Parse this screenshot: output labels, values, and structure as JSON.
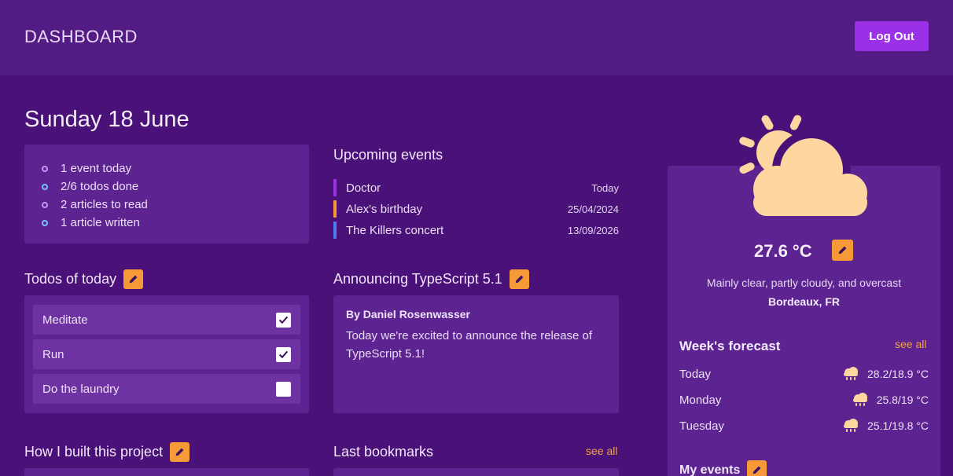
{
  "header": {
    "title": "DASHBOARD",
    "logout_label": "Log Out"
  },
  "date": "Sunday 18 June",
  "summary": [
    "1 event today",
    "2/6 todos done",
    "2 articles to read",
    "1 article written"
  ],
  "upcoming": {
    "title": "Upcoming events",
    "items": [
      {
        "name": "Doctor",
        "when": "Today",
        "color": "#9b30e6"
      },
      {
        "name": "Alex's birthday",
        "when": "25/04/2024",
        "color": "#f59a36"
      },
      {
        "name": "The Killers concert",
        "when": "13/09/2026",
        "color": "#4e7df0"
      }
    ]
  },
  "todos": {
    "title": "Todos of today",
    "items": [
      {
        "label": "Meditate",
        "done": true
      },
      {
        "label": "Run",
        "done": true
      },
      {
        "label": "Do the laundry",
        "done": false
      }
    ]
  },
  "article": {
    "title": "Announcing TypeScript 5.1",
    "author": "By Daniel Rosenwasser",
    "body": "Today we're excited to announce the release of TypeScript 5.1!"
  },
  "project": {
    "title": "How I built this project"
  },
  "bookmarks": {
    "title": "Last bookmarks",
    "see_all": "see all"
  },
  "weather": {
    "temperature": "27.6 °C",
    "description": "Mainly clear, partly cloudy, and overcast",
    "location": "Bordeaux, FR",
    "forecast_title": "Week's forecast",
    "see_all": "see all",
    "forecast": [
      {
        "day": "Today",
        "temps": "28.2/18.9 °C",
        "icon": "rain-cloud-icon"
      },
      {
        "day": "Monday",
        "temps": "25.8/19 °C",
        "icon": "rain-cloud-icon"
      },
      {
        "day": "Tuesday",
        "temps": "25.1/19.8 °C",
        "icon": "rain-cloud-icon"
      }
    ],
    "my_events_title": "My events"
  },
  "colors": {
    "accent": "#9b30e6",
    "edit": "#f59a36",
    "link": "#f5a43e",
    "weather_icon": "#fed7a0"
  }
}
